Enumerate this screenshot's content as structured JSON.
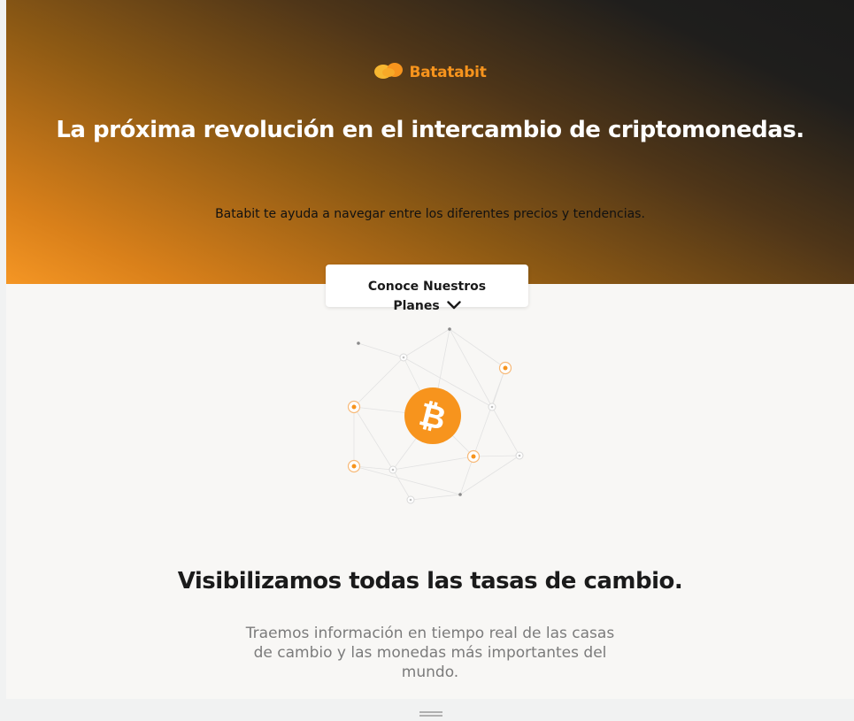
{
  "brand": {
    "name": "Batatabit",
    "accent_color": "#f7941d"
  },
  "hero": {
    "title": "La próxima revolución en el intercambio de criptomonedas.",
    "subtitle": "Batabit te ayuda a navegar entre los diferentes precios y tendencias."
  },
  "cta": {
    "line1": "Conoce Nuestros",
    "line2": "Planes",
    "icon": "chevron-down-icon"
  },
  "illustration": {
    "icon": "bitcoin-icon",
    "symbol": "₿",
    "color": "#f7941d"
  },
  "section": {
    "title": "Visibilizamos todas las tasas de cambio.",
    "text": "Traemos información en tiempo real de las casas de cambio y las monedas más importantes del mundo."
  },
  "scroll_handle": {
    "icon": "drag-handle-icon"
  }
}
